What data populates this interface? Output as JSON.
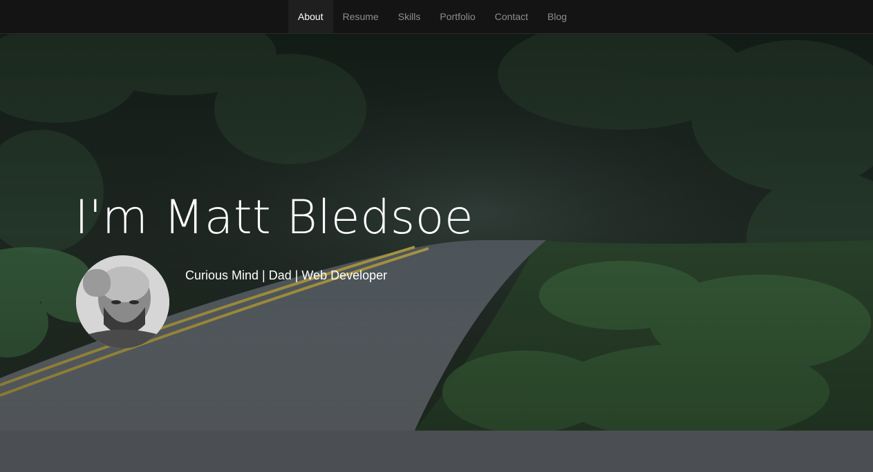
{
  "nav": {
    "items": [
      {
        "label": "About",
        "active": true
      },
      {
        "label": "Resume",
        "active": false
      },
      {
        "label": "Skills",
        "active": false
      },
      {
        "label": "Portfolio",
        "active": false
      },
      {
        "label": "Contact",
        "active": false
      },
      {
        "label": "Blog",
        "active": false
      }
    ]
  },
  "hero": {
    "title": "I'm Matt Bledsoe",
    "tagline": "Curious Mind | Dad | Web Developer",
    "background": "forest-road-photo",
    "avatar": "profile-photo"
  },
  "colors": {
    "navbar_bg": "#141414",
    "nav_active_bg": "#1f1f1f",
    "nav_text": "#8e8e8e",
    "nav_active_text": "#ffffff",
    "hero_text": "#ffffff",
    "section_bg": "#4b4e52"
  }
}
